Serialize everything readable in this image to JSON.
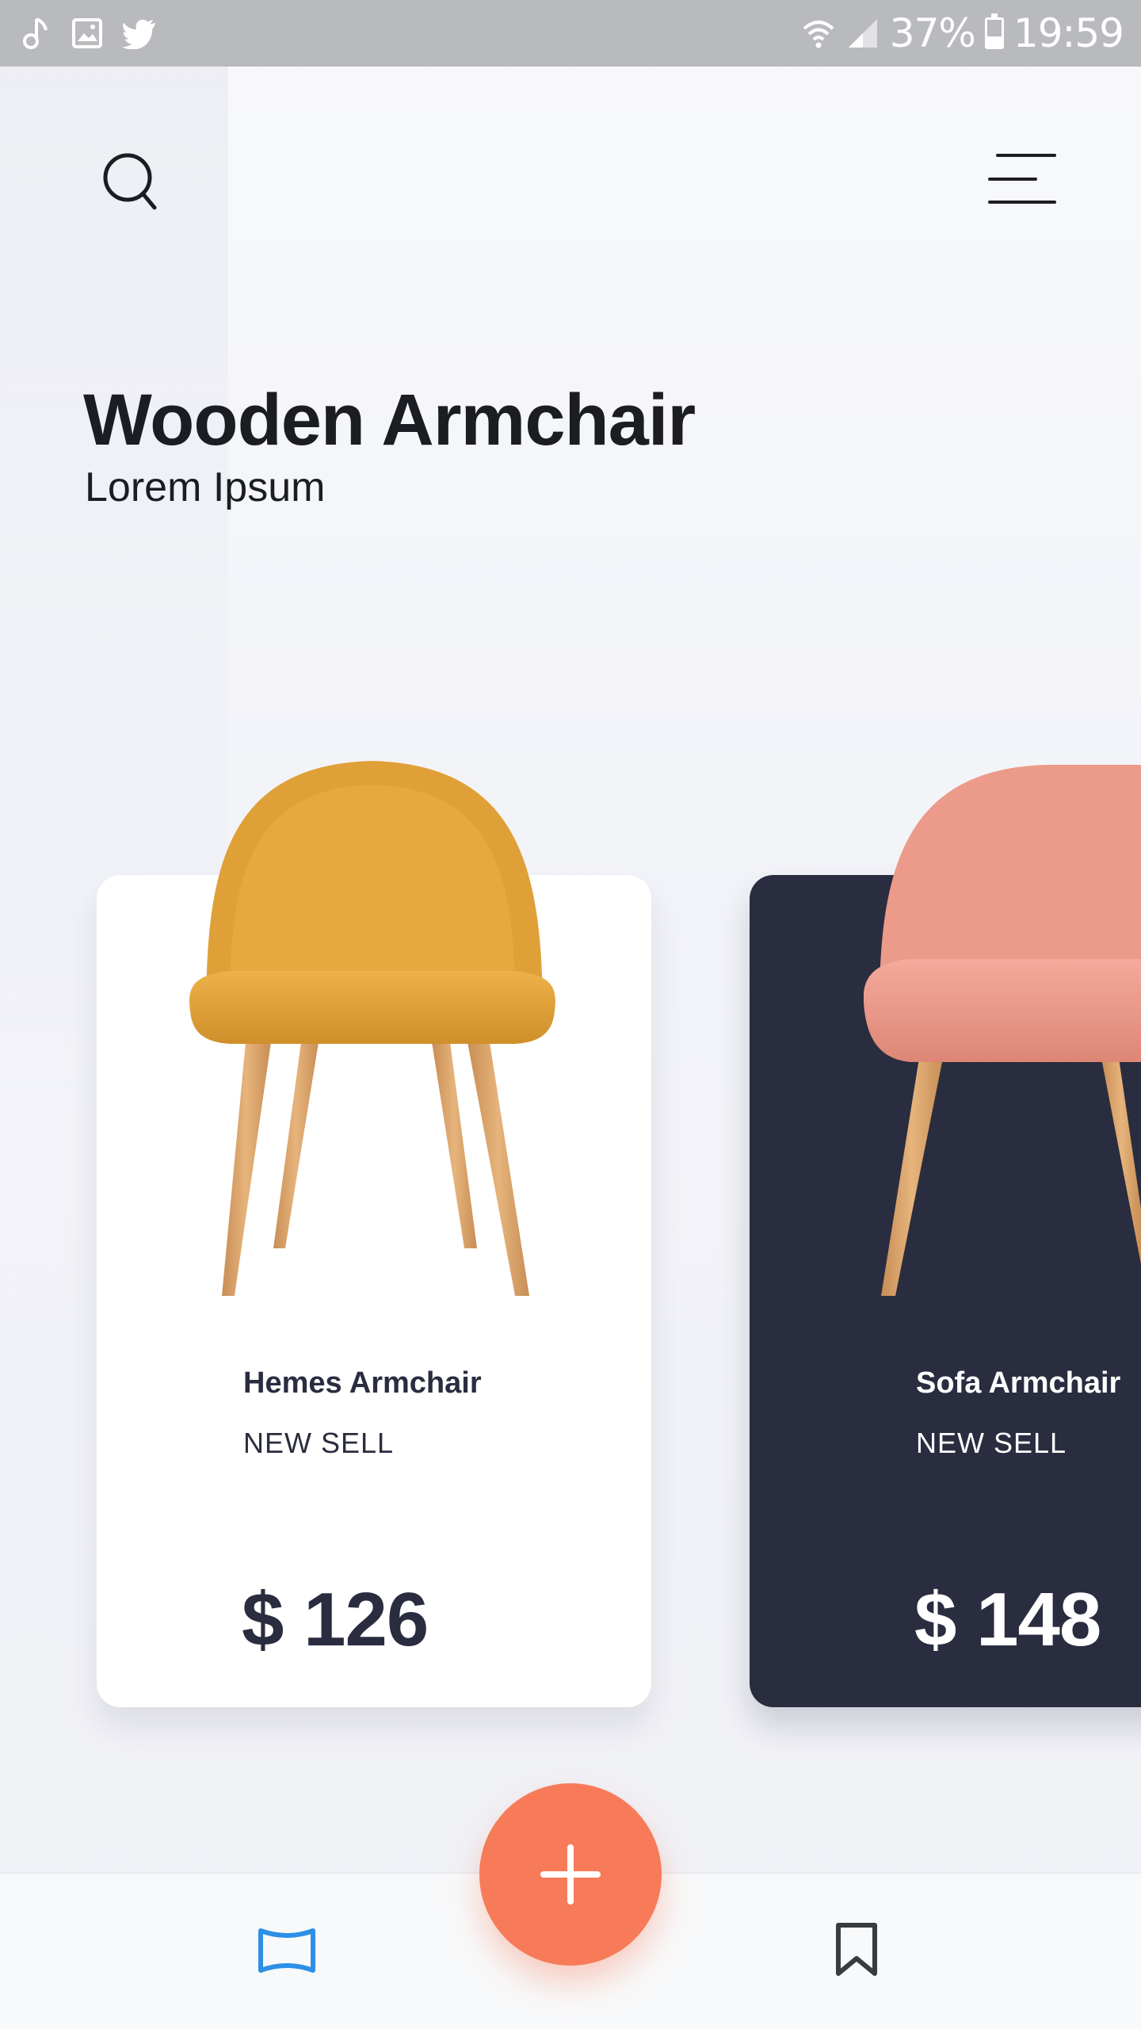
{
  "status_bar": {
    "battery_text": "37%",
    "time": "19:59",
    "battery_level": 0.37,
    "left_icons": [
      "music-note-icon",
      "image-icon",
      "twitter-icon"
    ],
    "right_icons": [
      "wifi-icon",
      "signal-icon",
      "battery-icon"
    ]
  },
  "header": {
    "search_icon": "search-icon",
    "menu_icon": "menu-icon"
  },
  "hero": {
    "title": "Wooden Armchair",
    "subtitle": "Lorem Ipsum"
  },
  "products": [
    {
      "name": "Hemes Armchair",
      "tag": "NEW SELL",
      "price": "$ 126",
      "card_color": "#ffffff",
      "chair_color": "#e1a33a"
    },
    {
      "name": "Sofa Armchair",
      "tag": "NEW SELL",
      "price": "$ 148",
      "card_color": "#2a2d3f",
      "chair_color": "#ef9b8c"
    }
  ],
  "bottom_nav": {
    "items": [
      "map-icon",
      "bookmark-icon"
    ],
    "active": "map-icon",
    "fab_icon": "plus-icon"
  },
  "colors": {
    "accent": "#f77b59",
    "active_nav": "#2e8fe6",
    "dark_card": "#2a2d3f"
  }
}
